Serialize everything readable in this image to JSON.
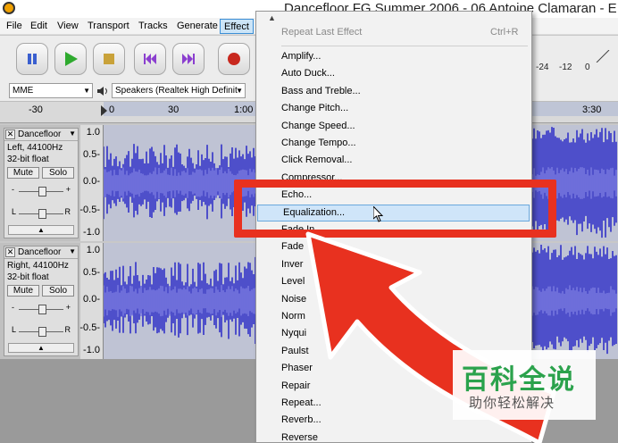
{
  "window": {
    "title": "Dancefloor FG Summer 2006 - 06 Antoine Clamaran - E"
  },
  "menubar": {
    "items": [
      "File",
      "Edit",
      "View",
      "Transport",
      "Tracks",
      "Generate",
      "Effect"
    ]
  },
  "transport": {
    "pause": "pause",
    "play": "play",
    "stop": "stop",
    "skip_start": "skip-start",
    "skip_end": "skip-end",
    "record": "record"
  },
  "meter": {
    "labels": [
      "-24",
      "-12",
      "0"
    ]
  },
  "devices": {
    "host": "MME",
    "output": "Speakers (Realtek High Definit"
  },
  "timeline": {
    "labels": [
      "-30",
      "0",
      "30",
      "1:00",
      "3:30"
    ]
  },
  "tracks": [
    {
      "name": "Dancefloor",
      "info1": "Left, 44100Hz",
      "info2": "32-bit float",
      "mute": "Mute",
      "solo": "Solo",
      "gain_minus": "-",
      "gain_plus": "+",
      "pan_l": "L",
      "pan_r": "R",
      "scale": [
        "1.0",
        "0.5-",
        "0.0-",
        "-0.5-",
        "-1.0"
      ]
    },
    {
      "name": "Dancefloor",
      "info1": "Right, 44100Hz",
      "info2": "32-bit float",
      "mute": "Mute",
      "solo": "Solo",
      "gain_minus": "-",
      "gain_plus": "+",
      "pan_l": "L",
      "pan_r": "R",
      "scale": [
        "1.0",
        "0.5-",
        "0.0-",
        "-0.5-",
        "-1.0"
      ]
    }
  ],
  "effect_menu": {
    "repeat_last": {
      "label": "Repeat Last Effect",
      "accel": "Ctrl+R"
    },
    "items": [
      "Amplify...",
      "Auto Duck...",
      "Bass and Treble...",
      "Change Pitch...",
      "Change Speed...",
      "Change Tempo...",
      "Click Removal...",
      "Compressor...",
      "Echo...",
      "Equalization...",
      "Fade In",
      "Fade",
      "Inver",
      "Level",
      "Noise",
      "Norm",
      "Nyqui",
      "Paulst",
      "Phaser",
      "Repair",
      "Repeat...",
      "Reverb...",
      "Reverse"
    ],
    "highlighted": "Equalization..."
  },
  "watermark": {
    "main": "百科全说",
    "sub": "助你轻松解决"
  },
  "colors": {
    "waveform": "#3232c8",
    "highlight_box": "#e8311f",
    "watermark_green": "#2ba24c"
  }
}
